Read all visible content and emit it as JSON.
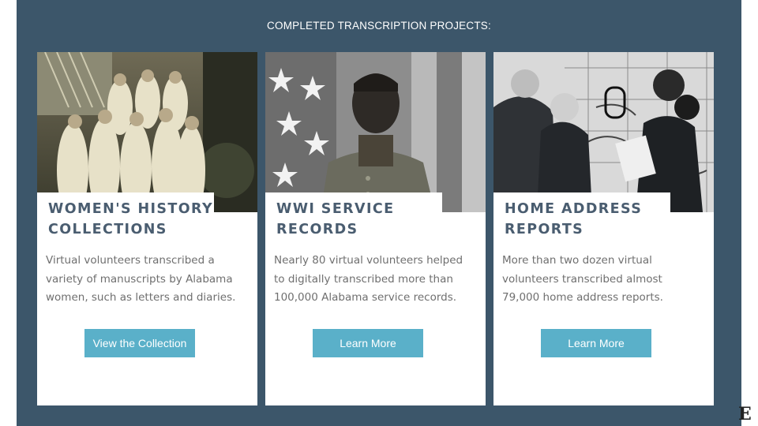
{
  "section": {
    "title": "COMPLETED TRANSCRIPTION PROJECTS:"
  },
  "cards": [
    {
      "image_icon": "photo-group-of-women",
      "title_line1": "WOMEN'S HISTORY",
      "title_line2": "COLLECTIONS",
      "text_line1": "Virtual volunteers transcribed a",
      "text_line2": "variety of manuscripts by Alabama",
      "text_line3": "women, such as letters and diaries.",
      "button_label": "View the Collection"
    },
    {
      "image_icon": "photo-soldier-portrait",
      "title_line1": "WWI SERVICE",
      "title_line2": "RECORDS",
      "text_line1": "Nearly 80 virtual volunteers helped",
      "text_line2": "to digitally transcribed more than",
      "text_line3": "100,000 Alabama service records.",
      "button_label": "Learn More"
    },
    {
      "image_icon": "photo-women-at-map",
      "title_line1": "HOME ADDRESS",
      "title_line2": "REPORTS",
      "text_line1": "More than two dozen virtual",
      "text_line2": "volunteers transcribed almost",
      "text_line3": "79,000 home address reports.",
      "button_label": "Learn More"
    }
  ],
  "edge": {
    "glyph": "E"
  },
  "colors": {
    "panel": "#3c566a",
    "button": "#5ab0c9",
    "title": "#4a5d70",
    "body_text": "#6f6f6f"
  }
}
